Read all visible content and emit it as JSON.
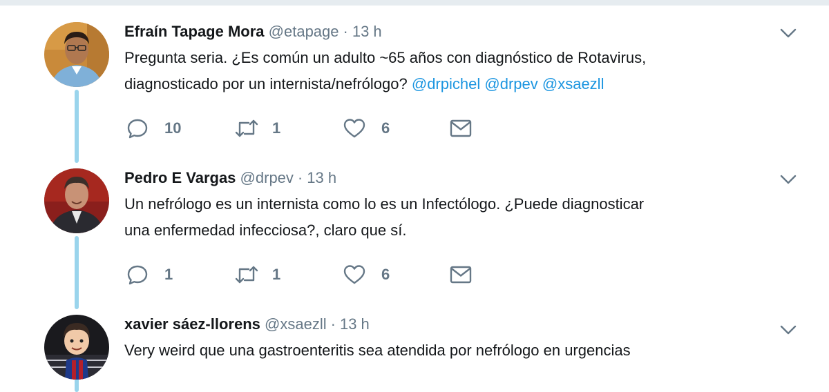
{
  "tweets": [
    {
      "name": "Efraín Tapage Mora",
      "handle": "@etapage",
      "separator": "·",
      "time": "13 h",
      "text_line1": "Pregunta seria. ¿Es común un adulto ~65 años con diagnóstico de Rotavirus,",
      "text_line2": "diagnosticado por un internista/nefrólogo?",
      "mentions": [
        "@drpichel",
        "@drpev",
        "@xsaezll"
      ],
      "replies": "10",
      "retweets": "1",
      "likes": "6"
    },
    {
      "name": "Pedro E Vargas",
      "handle": "@drpev",
      "separator": "·",
      "time": "13 h",
      "text_line1": "Un nefrólogo es un internista como lo es un Infectólogo. ¿Puede diagnosticar",
      "text_line2": "una enfermedad infecciosa?, claro que sí.",
      "replies": "1",
      "retweets": "1",
      "likes": "6"
    },
    {
      "name": "xavier sáez-llorens",
      "handle": "@xsaezll",
      "separator": "·",
      "time": "13 h",
      "text_line1": "Very weird que una gastroenteritis sea atendida por nefrólogo en urgencias"
    }
  ],
  "icons": {
    "reply": "reply-icon",
    "retweet": "retweet-icon",
    "like": "heart-icon",
    "message": "envelope-icon",
    "menu": "chevron-down-icon"
  },
  "colors": {
    "text": "#14171a",
    "secondary": "#657786",
    "mention": "#1b95e0",
    "thread_line": "#9ad4ec",
    "icon": "#657786"
  }
}
